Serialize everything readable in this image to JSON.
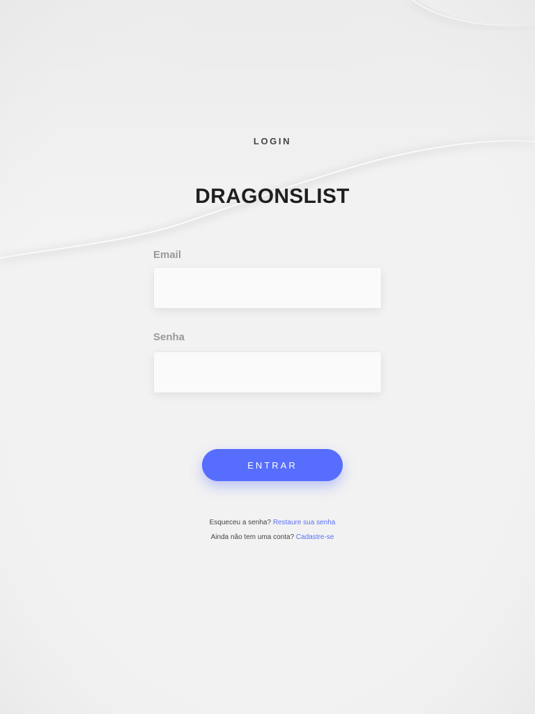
{
  "header": {
    "eyebrow": "LOGIN",
    "brand": "DRAGONSLIST"
  },
  "form": {
    "email_label": "Email",
    "email_value": "",
    "senha_label": "Senha",
    "senha_value": "",
    "submit_label": "ENTRAR"
  },
  "footer": {
    "forgot_text": "Esqueceu a senha?",
    "forgot_link": "Restaure sua senha",
    "signup_text": "Ainda não tem uma conta?",
    "signup_link": "Cadastre-se"
  },
  "colors": {
    "accent": "#566dfe",
    "link": "#5a6ff5",
    "background": "#f2f2f2"
  }
}
